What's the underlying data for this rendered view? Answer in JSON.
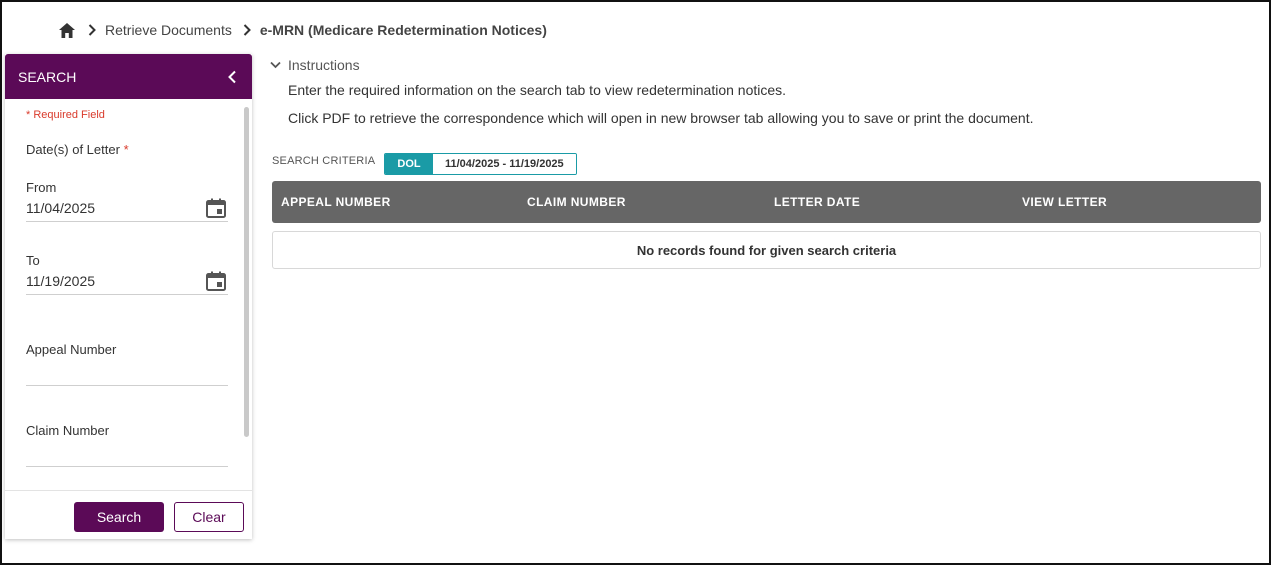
{
  "breadcrumb": {
    "home_icon": "home-icon",
    "items": [
      "Retrieve Documents",
      "e-MRN (Medicare Redetermination Notices)"
    ]
  },
  "sidebar": {
    "title": "SEARCH",
    "required_note": "* Required Field",
    "dates_label": "Date(s) of Letter",
    "required_star": "*",
    "from_label": "From",
    "from_value": "11/04/2025",
    "to_label": "To",
    "to_value": "11/19/2025",
    "appeal_label": "Appeal Number",
    "appeal_value": "",
    "claim_label": "Claim Number",
    "claim_value": "",
    "search_button": "Search",
    "clear_button": "Clear"
  },
  "instructions": {
    "toggle_label": "Instructions",
    "line1": "Enter the required information on the search tab to view redetermination notices.",
    "line2": "Click PDF to retrieve the correspondence which will open in new browser tab allowing you to save or print the document."
  },
  "criteria": {
    "label": "SEARCH CRITERIA",
    "chip_key": "DOL",
    "chip_value": "11/04/2025 - 11/19/2025"
  },
  "table": {
    "columns": [
      "APPEAL NUMBER",
      "CLAIM NUMBER",
      "LETTER DATE",
      "VIEW LETTER"
    ],
    "empty_message": "No records found for given search criteria"
  },
  "colors": {
    "primary": "#5b0a57",
    "accent": "#1a9ba6",
    "header_gray": "#666666",
    "required": "#d93a2b"
  }
}
